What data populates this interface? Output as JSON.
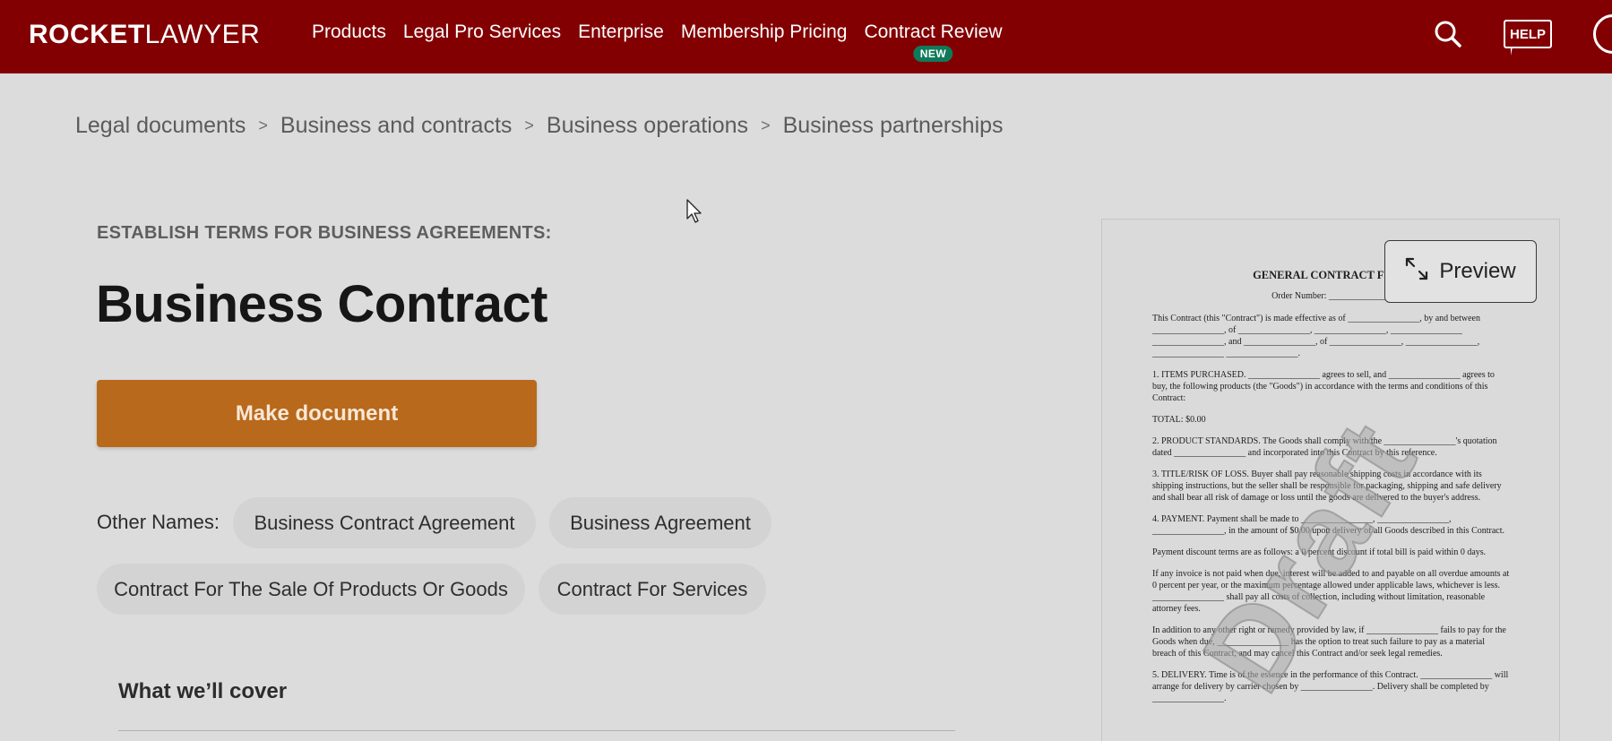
{
  "header": {
    "logo_bold": "ROCKET",
    "logo_thin": "LAWYER",
    "nav": [
      {
        "label": "Products"
      },
      {
        "label": "Legal Pro Services"
      },
      {
        "label": "Enterprise"
      },
      {
        "label": "Membership Pricing"
      },
      {
        "label": "Contract Review",
        "badge": "NEW"
      }
    ],
    "help_label": "HELP",
    "icons": {
      "search": "search-icon",
      "help": "help-icon",
      "avatar": "avatar"
    }
  },
  "breadcrumb": [
    "Legal documents",
    "Business and contracts",
    "Business operations",
    "Business partnerships"
  ],
  "breadcrumb_separator": ">",
  "main": {
    "eyebrow": "ESTABLISH TERMS FOR BUSINESS AGREEMENTS:",
    "title": "Business Contract",
    "make_button": "Make document",
    "other_names_label": "Other Names:",
    "other_names": [
      "Business Contract Agreement",
      "Business Agreement",
      "Contract For The Sale Of Products Or Goods",
      "Contract For Services"
    ],
    "cover_title": "What we’ll cover"
  },
  "preview": {
    "button_label": "Preview",
    "watermark": "Draft",
    "doc_title": "GENERAL CONTRACT FOR P",
    "order_number": "Order Number: ______________",
    "paragraphs": [
      "This Contract (this \"Contract\") is made effective as of ________________, by and between ________________, of ________________, ________________, ________________ ________________, and ________________, of ________________, ________________, ________________ ________________.",
      "1. ITEMS PURCHASED. ________________ agrees to sell, and ________________ agrees to buy, the following products (the \"Goods\") in accordance with the terms and conditions of this Contract:",
      "TOTAL: $0.00",
      "2. PRODUCT STANDARDS. The Goods shall comply with the ________________'s quotation dated ________________ and incorporated into this Contract by this reference.",
      "3. TITLE/RISK OF LOSS. Buyer shall pay reasonable shipping costs in accordance with its shipping instructions, but the seller shall be responsible for packaging, shipping and safe delivery and shall bear all risk of damage or loss until the goods are delivered to the buyer's address.",
      "4. PAYMENT. Payment shall be made to ________________, ________________, ________________, in the amount of $0.00 upon delivery of all Goods described in this Contract.",
      "Payment discount terms are as follows: a 0 percent discount if total bill is paid within 0 days.",
      "If any invoice is not paid when due, interest will be added to and payable on all overdue amounts at 0 percent per year, or the maximum percentage allowed under applicable laws, whichever is less. ________________ shall pay all costs of collection, including without limitation, reasonable attorney fees.",
      "In addition to any other right or remedy provided by law, if ________________ fails to pay for the Goods when due, ________________ has the option to treat such failure to pay as a material breach of this Contract, and may cancel this Contract and/or seek legal remedies.",
      "5. DELIVERY. Time is of the essence in the performance of this Contract. ________________ will arrange for delivery by carrier chosen by ________________. Delivery shall be completed by ________________."
    ]
  }
}
